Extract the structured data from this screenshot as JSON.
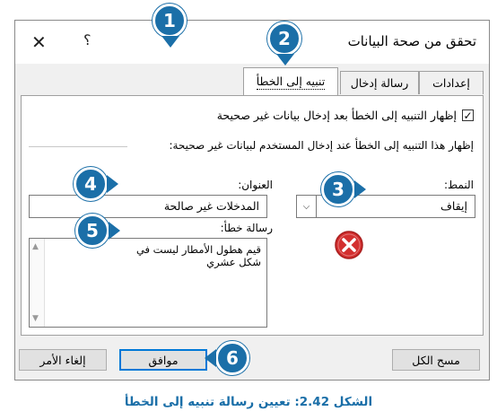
{
  "dialog": {
    "title": "تحقق من صحة البيانات",
    "close_label": "✕",
    "help_label": "؟"
  },
  "tabs": [
    {
      "label": "إعدادات",
      "active": false
    },
    {
      "label": "رسالة إدخال",
      "active": false
    },
    {
      "label": "تنبيه إلى الخطأ",
      "active": true
    }
  ],
  "panel": {
    "show_alert_checkbox": {
      "label": "إظهار التنبيه إلى الخطأ بعد إدخال بيانات غير صحيحة",
      "checked": true,
      "mark": "✓"
    },
    "section_label": "إظهار هذا التنبيه إلى الخطأ عند إدخال المستخدم لبيانات غير صحيحة:",
    "style": {
      "label": "النمط:",
      "value": "إيقاف",
      "arrow": "⌵"
    },
    "title_field": {
      "label": "العنوان:",
      "value": "المدخلات غير صالحة"
    },
    "message_field": {
      "label": "رسالة خطأ:",
      "value": "قيم هطول الأمطار ليست في شكل عشري"
    },
    "scroll_up": "▲",
    "scroll_down": "▼",
    "icon": "error-stop-icon"
  },
  "buttons": {
    "clear_all": "مسح الكل",
    "ok": "موافق",
    "cancel": "إلغاء الأمر"
  },
  "callouts": [
    "1",
    "2",
    "3",
    "4",
    "5",
    "6"
  ],
  "caption": "الشكل 2.42: تعيين رسالة تنبيه إلى الخطأ",
  "colors": {
    "callout": "#1b6fa8",
    "error_red": "#d32f2f",
    "accent": "#0078d7"
  }
}
